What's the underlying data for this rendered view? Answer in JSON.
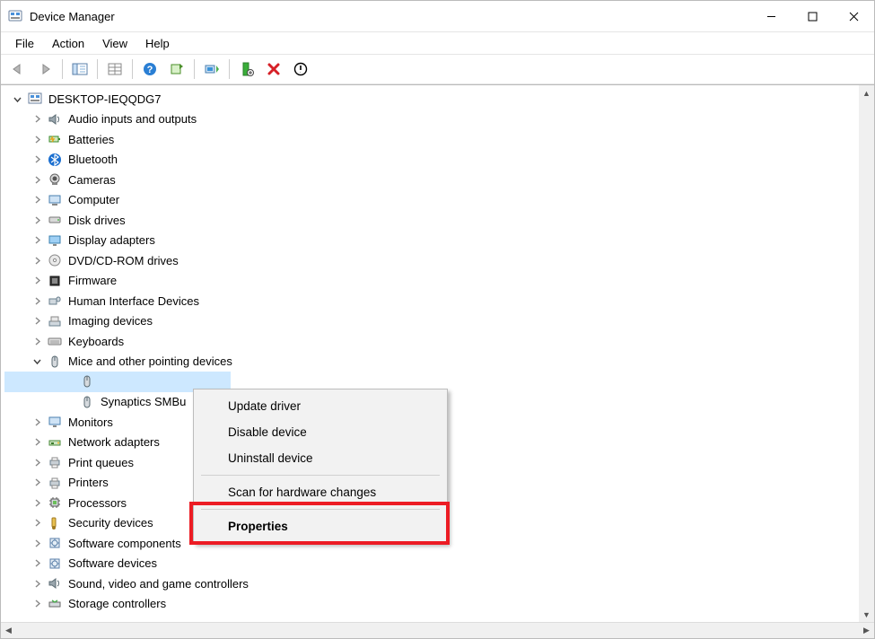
{
  "window_title": "Device Manager",
  "menus": {
    "file": "File",
    "action": "Action",
    "view": "View",
    "help": "Help"
  },
  "root": "DESKTOP-IEQQDG7",
  "categories": [
    {
      "label": "Audio inputs and outputs",
      "icon": "speaker"
    },
    {
      "label": "Batteries",
      "icon": "battery"
    },
    {
      "label": "Bluetooth",
      "icon": "bluetooth"
    },
    {
      "label": "Cameras",
      "icon": "camera"
    },
    {
      "label": "Computer",
      "icon": "computer"
    },
    {
      "label": "Disk drives",
      "icon": "disk"
    },
    {
      "label": "Display adapters",
      "icon": "display"
    },
    {
      "label": "DVD/CD-ROM drives",
      "icon": "dvd"
    },
    {
      "label": "Firmware",
      "icon": "firmware"
    },
    {
      "label": "Human Interface Devices",
      "icon": "hid"
    },
    {
      "label": "Imaging devices",
      "icon": "imaging"
    },
    {
      "label": "Keyboards",
      "icon": "keyboard"
    },
    {
      "label": "Mice and other pointing devices",
      "icon": "mouse",
      "expanded": true
    },
    {
      "label": "Monitors",
      "icon": "monitor"
    },
    {
      "label": "Network adapters",
      "icon": "network"
    },
    {
      "label": "Print queues",
      "icon": "printer"
    },
    {
      "label": "Printers",
      "icon": "printer"
    },
    {
      "label": "Processors",
      "icon": "cpu"
    },
    {
      "label": "Security devices",
      "icon": "security"
    },
    {
      "label": "Software components",
      "icon": "software"
    },
    {
      "label": "Software devices",
      "icon": "software"
    },
    {
      "label": "Sound, video and game controllers",
      "icon": "speaker"
    },
    {
      "label": "Storage controllers",
      "icon": "storage"
    }
  ],
  "mice_children": [
    {
      "label": "",
      "icon": "mouse",
      "selected": true
    },
    {
      "label": "Synaptics SMBu",
      "icon": "mouse"
    }
  ],
  "context_menu": {
    "update": "Update driver",
    "disable": "Disable device",
    "uninstall": "Uninstall device",
    "scan": "Scan for hardware changes",
    "properties": "Properties"
  }
}
